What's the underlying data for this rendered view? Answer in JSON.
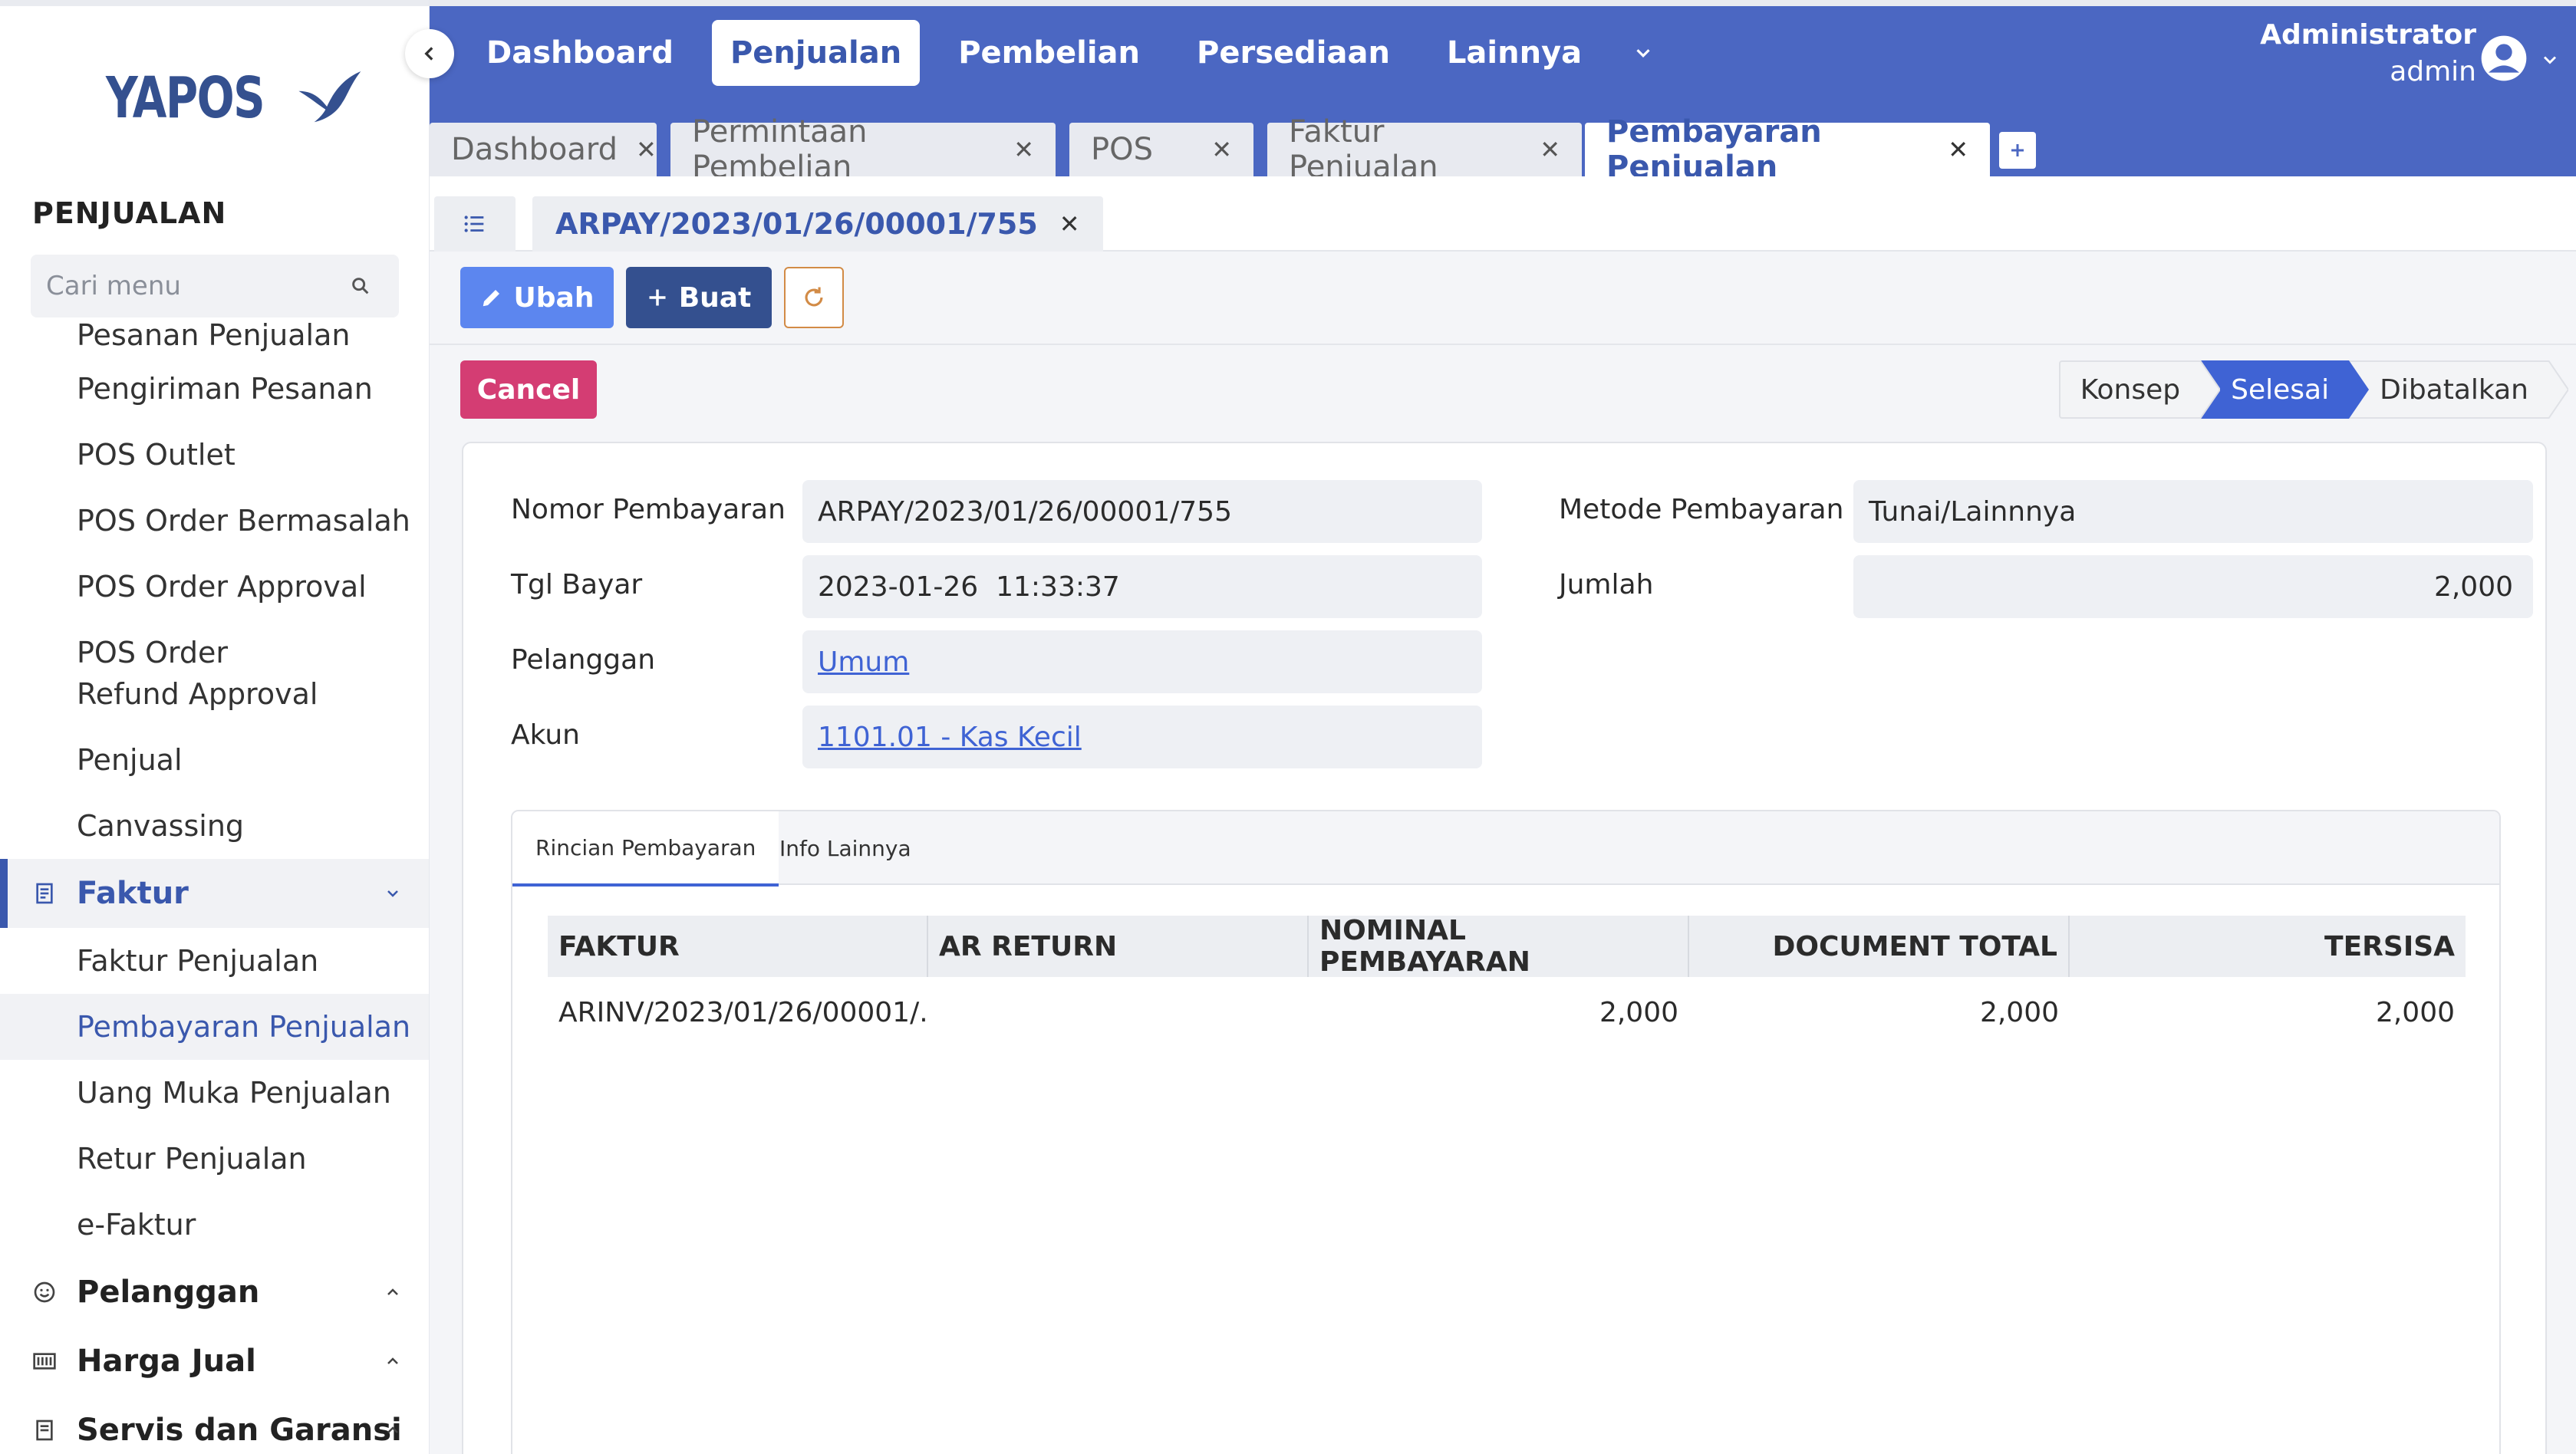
{
  "brand": {
    "logo_text": "YAPOS"
  },
  "sidebar": {
    "section_title": "PENJUALAN",
    "search_placeholder": "Cari menu",
    "items_top": [
      {
        "label": "Pesanan Penjualan"
      },
      {
        "label": "Pengiriman Pesanan"
      },
      {
        "label": "POS Outlet"
      },
      {
        "label": "POS Order Bermasalah"
      },
      {
        "label": "POS Order Approval"
      },
      {
        "label": "POS Order Refund Approval"
      },
      {
        "label": "Penjual"
      },
      {
        "label": "Canvassing"
      }
    ],
    "group_faktur": {
      "label": "Faktur",
      "icon": "receipt-icon"
    },
    "items_faktur": [
      {
        "label": "Faktur Penjualan"
      },
      {
        "label": "Pembayaran Penjualan"
      },
      {
        "label": "Uang Muka Penjualan"
      },
      {
        "label": "Retur Penjualan"
      },
      {
        "label": "e-Faktur"
      }
    ],
    "group_pelanggan": {
      "label": "Pelanggan",
      "icon": "smile-icon"
    },
    "group_harga": {
      "label": "Harga Jual",
      "icon": "barcode-icon"
    },
    "group_servis": {
      "label": "Servis dan Garansi",
      "icon": "document-icon"
    }
  },
  "topnav": {
    "items": [
      "Dashboard",
      "Penjualan",
      "Pembelian",
      "Persediaan",
      "Lainnya"
    ],
    "active": "Penjualan",
    "user_name": "Administrator",
    "user_role": "admin"
  },
  "tabs": [
    "Dashboard",
    "Permintaan Pembelian",
    "POS",
    "Faktur Penjualan",
    "Pembayaran Penjualan"
  ],
  "active_tab": "Pembayaran Penjualan",
  "doc_tab": "ARPAY/2023/01/26/00001/755",
  "toolbar": {
    "edit_label": "Ubah",
    "create_label": "Buat"
  },
  "actions": {
    "cancel_label": "Cancel"
  },
  "status_steps": [
    "Konsep",
    "Selesai",
    "Dibatalkan"
  ],
  "status_active": "Selesai",
  "form": {
    "nomor_label": "Nomor Pembayaran",
    "nomor_value": "ARPAY/2023/01/26/00001/755",
    "tgl_label": "Tgl Bayar",
    "tgl_value": "2023-01-26  11:33:37",
    "pelanggan_label": "Pelanggan",
    "pelanggan_value": "Umum",
    "akun_label": "Akun",
    "akun_value": "1101.01 - Kas Kecil",
    "metode_label": "Metode Pembayaran",
    "metode_value": "Tunai/Lainnnya",
    "jumlah_label": "Jumlah",
    "jumlah_value": "2,000"
  },
  "detail_tabs": [
    "Rincian Pembayaran",
    "Info Lainnya"
  ],
  "table": {
    "headers": [
      "FAKTUR",
      "AR RETURN",
      "NOMINAL PEMBAYARAN",
      "DOCUMENT TOTAL",
      "TERSISA"
    ],
    "rows": [
      [
        "ARINV/2023/01/26/00001/...",
        "",
        "2,000",
        "2,000",
        "2,000"
      ]
    ]
  },
  "colors": {
    "primary": "#4b67c2",
    "brand_dark": "#34508f",
    "accent_blue": "#3f63d4",
    "cancel": "#d43d73",
    "refresh_border": "#d28b46"
  }
}
